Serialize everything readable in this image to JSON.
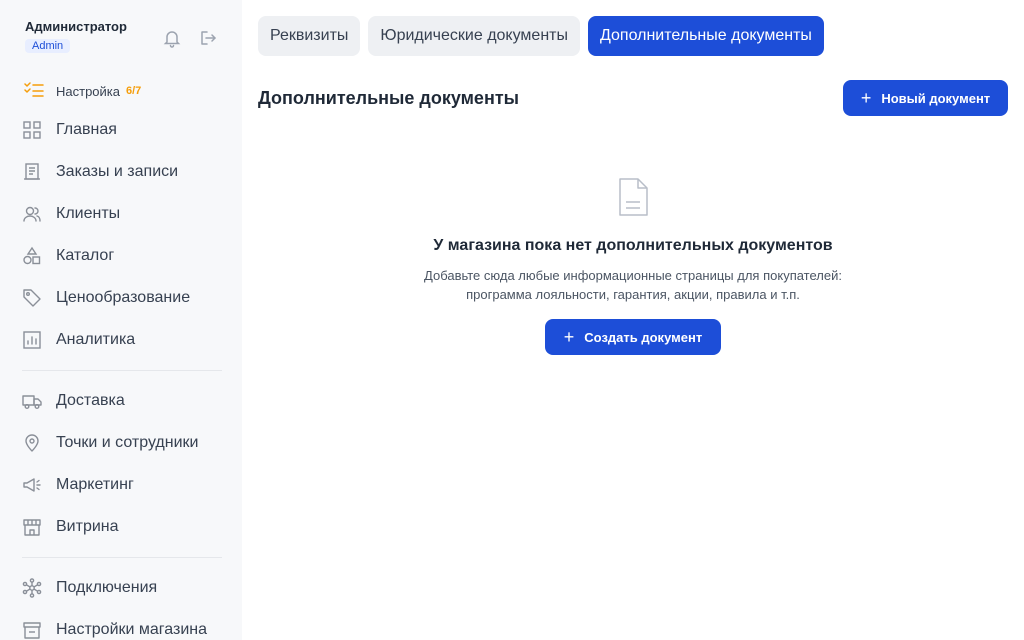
{
  "profile": {
    "name": "Администратор",
    "role": "Admin"
  },
  "icons": {
    "notifications": "bell-icon",
    "logout": "logout-icon"
  },
  "setup": {
    "label": "Настройка",
    "progress": "6/7"
  },
  "sidebar": {
    "items": [
      {
        "label": "Главная",
        "icon": "dashboard-icon"
      },
      {
        "label": "Заказы и записи",
        "icon": "orders-icon"
      },
      {
        "label": "Клиенты",
        "icon": "clients-icon"
      },
      {
        "label": "Каталог",
        "icon": "catalog-icon"
      },
      {
        "label": "Ценообразование",
        "icon": "price-tag-icon"
      },
      {
        "label": "Аналитика",
        "icon": "analytics-icon"
      },
      {
        "label": "Доставка",
        "icon": "truck-icon"
      },
      {
        "label": "Точки и сотрудники",
        "icon": "location-pin-icon"
      },
      {
        "label": "Маркетинг",
        "icon": "megaphone-icon"
      },
      {
        "label": "Витрина",
        "icon": "storefront-icon"
      },
      {
        "label": "Подключения",
        "icon": "integrations-icon"
      },
      {
        "label": "Настройки магазина",
        "icon": "store-settings-icon"
      }
    ]
  },
  "tabs": [
    {
      "label": "Реквизиты",
      "active": false
    },
    {
      "label": "Юридические документы",
      "active": false
    },
    {
      "label": "Дополнительные документы",
      "active": true
    }
  ],
  "main": {
    "title": "Дополнительные документы",
    "new_button": "Новый документ",
    "empty": {
      "title": "У магазина пока нет дополнительных документов",
      "line1": "Добавьте сюда любые информационные страницы для покупателей:",
      "line2": "программа лояльности, гарантия, акции, правила и т.п.",
      "button": "Создать документ"
    }
  },
  "colors": {
    "accent": "#1d4ed8",
    "sidebar_bg": "#f7f8fa",
    "warning": "#f59e0b",
    "tab_bg": "#eef0f3"
  }
}
